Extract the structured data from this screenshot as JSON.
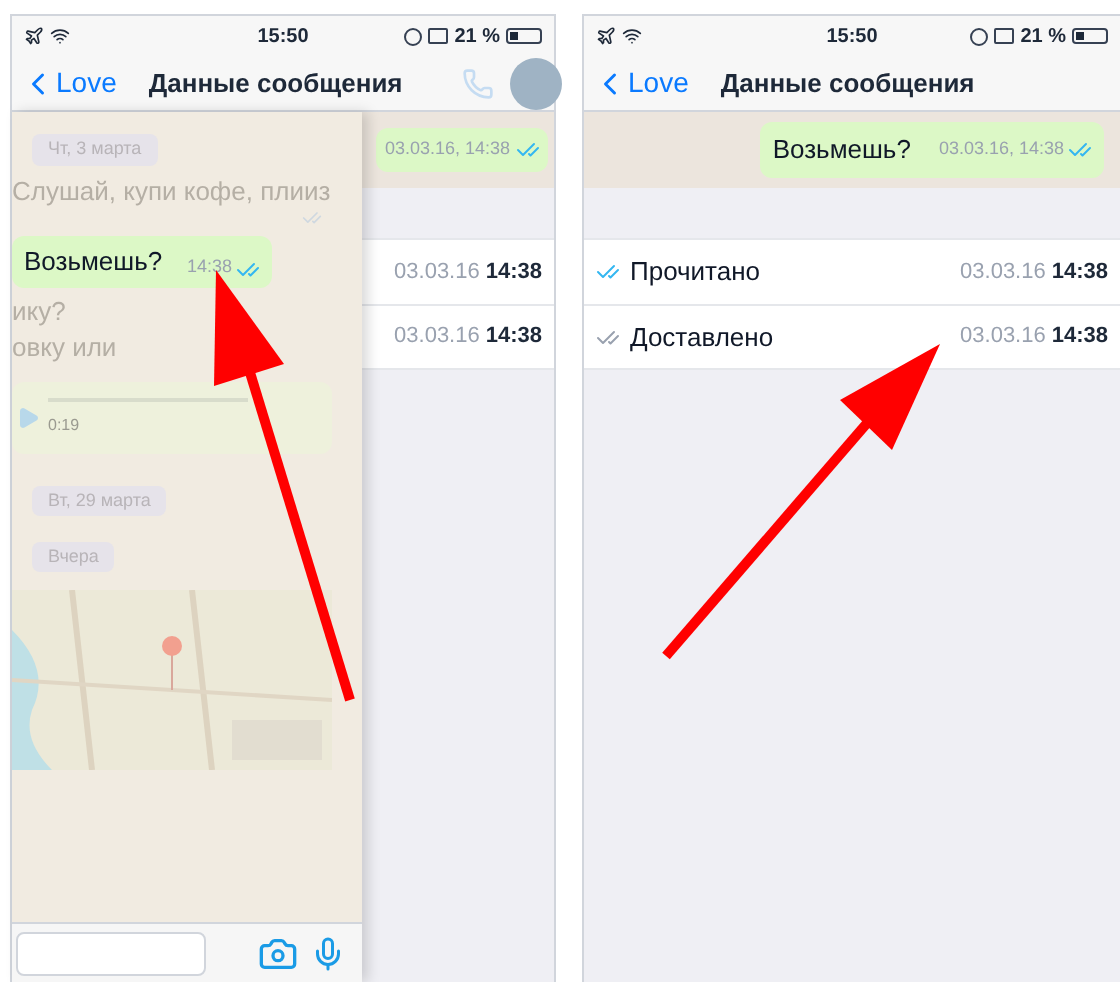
{
  "left_phone": {
    "status": {
      "time": "15:50",
      "battery": "21 %"
    },
    "nav": {
      "back": "Love",
      "title": "Данные сообщения"
    },
    "bubble_time": "03.03.16, 14:38",
    "receipts": [
      {
        "date": "03.03.16",
        "time": "14:38"
      },
      {
        "date": "03.03.16",
        "time": "14:38"
      }
    ],
    "chat": [
      {
        "kind": "date",
        "text": "Чт, 3 марта"
      },
      {
        "kind": "ghost",
        "text": "Слушай, купи кофе, плииз",
        "tick": true
      },
      {
        "kind": "bubble",
        "text": "Возьмешь?",
        "time": "14:38"
      },
      {
        "kind": "ghost",
        "text": "ику?",
        "tick": false
      },
      {
        "kind": "ghost",
        "text": "овку или",
        "tick": false
      },
      {
        "kind": "voice",
        "duration": "0:19"
      },
      {
        "kind": "date",
        "text": "Вт, 29 марта"
      },
      {
        "kind": "date",
        "text": "Вчера"
      },
      {
        "kind": "map"
      }
    ]
  },
  "right_phone": {
    "status": {
      "time": "15:50",
      "battery": "21 %"
    },
    "nav": {
      "back": "Love",
      "title": "Данные сообщения"
    },
    "bubble": {
      "text": "Возьмешь?",
      "time": "03.03.16, 14:38"
    },
    "receipts": [
      {
        "label": "Прочитано",
        "read": true,
        "date": "03.03.16",
        "time": "14:38"
      },
      {
        "label": "Доставлено",
        "read": false,
        "date": "03.03.16",
        "time": "14:38"
      }
    ]
  }
}
